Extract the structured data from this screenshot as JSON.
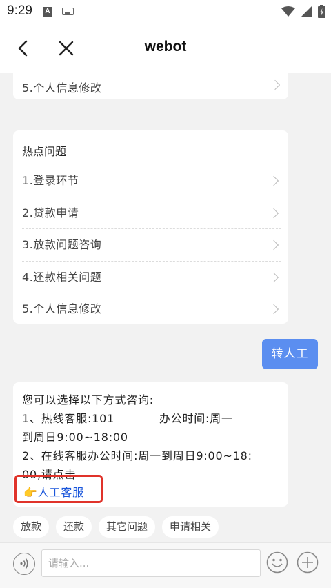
{
  "status_bar": {
    "time": "9:29",
    "a_icon": "A",
    "icons": [
      "a-notification-icon",
      "keyboard-icon",
      "wifi-icon",
      "signal-icon",
      "battery-icon"
    ]
  },
  "nav": {
    "title": "webot",
    "back_icon": "back-arrow-icon",
    "close_icon": "close-icon"
  },
  "partial_card": {
    "item_label": "5.个人信息修改"
  },
  "hot_card": {
    "title": "热点问题",
    "items": [
      {
        "label": "1.登录环节"
      },
      {
        "label": "2.贷款申请"
      },
      {
        "label": "3.放款问题咨询"
      },
      {
        "label": "4.还款相关问题"
      },
      {
        "label": "5.个人信息修改"
      }
    ]
  },
  "user_message": "转人工",
  "info_card": {
    "lines": [
      "您可以选择以下方式咨询:",
      "1、热线客服:101           办公时间:周一",
      "到周日9:00~18:00",
      "2、在线客服办公时间:周一到周日9:00~18:",
      "00,请点击"
    ],
    "link_emoji": "👉",
    "link_label": "人工客服"
  },
  "quick_replies": [
    "放款",
    "还款",
    "其它问题",
    "申请相关"
  ],
  "input_bar": {
    "placeholder": "请输入...",
    "voice_icon": "voice-icon",
    "emoji_icon": "emoji-icon",
    "plus_icon": "plus-icon"
  },
  "colors": {
    "accent_bubble": "#5b8ef0",
    "link": "#1a56db",
    "highlight_border": "#e0332a"
  }
}
